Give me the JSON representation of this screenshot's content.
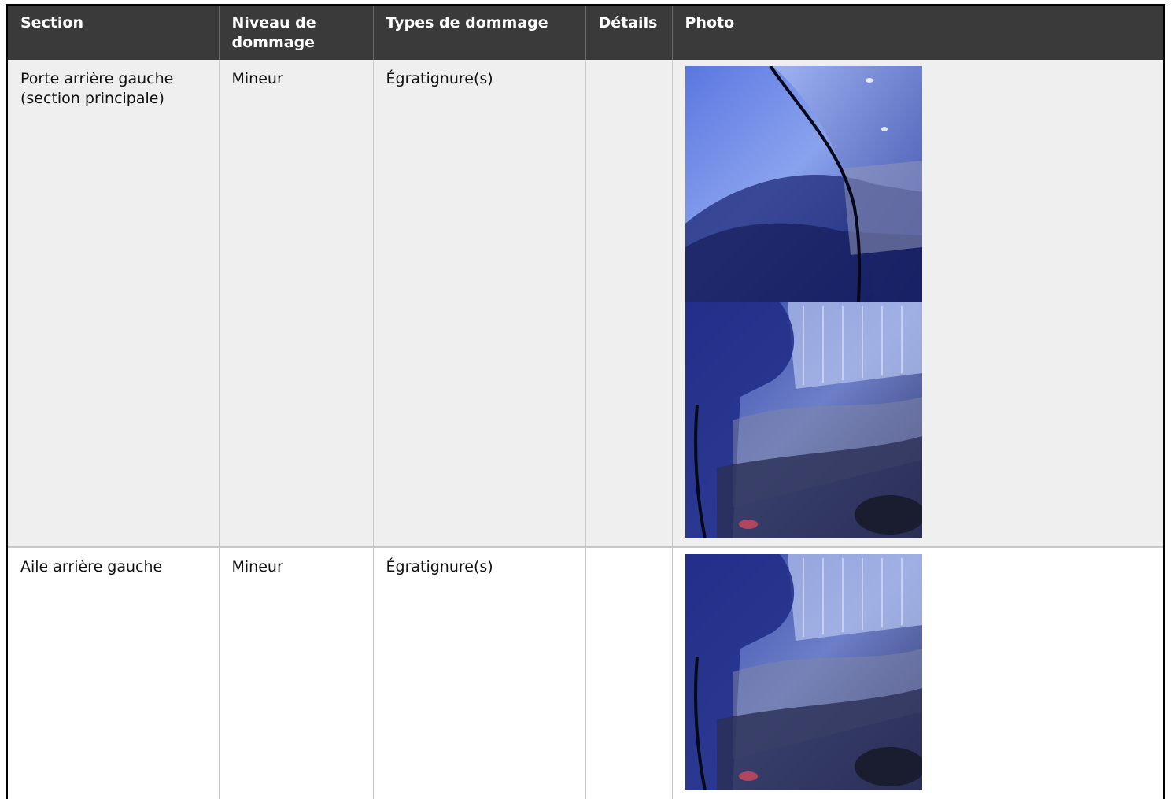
{
  "table": {
    "headers": {
      "section": "Section",
      "niveau": "Niveau de dommage",
      "types": "Types de dommage",
      "details": "Détails",
      "photo": "Photo"
    },
    "rows": [
      {
        "section": "Porte arrière gauche (section principale)",
        "niveau": "Mineur",
        "types": "Égratignure(s)",
        "details": "",
        "photos": [
          "car-door-panel-photo",
          "car-rear-panel-photo"
        ]
      },
      {
        "section": "Aile arrière gauche",
        "niveau": "Mineur",
        "types": "Égratignure(s)",
        "details": "",
        "photos": [
          "car-rear-panel-photo"
        ]
      }
    ]
  },
  "colors": {
    "header_bg": "#3a3a3a",
    "row_alt_bg": "#efefef",
    "car_paint": "#3b52b8"
  }
}
